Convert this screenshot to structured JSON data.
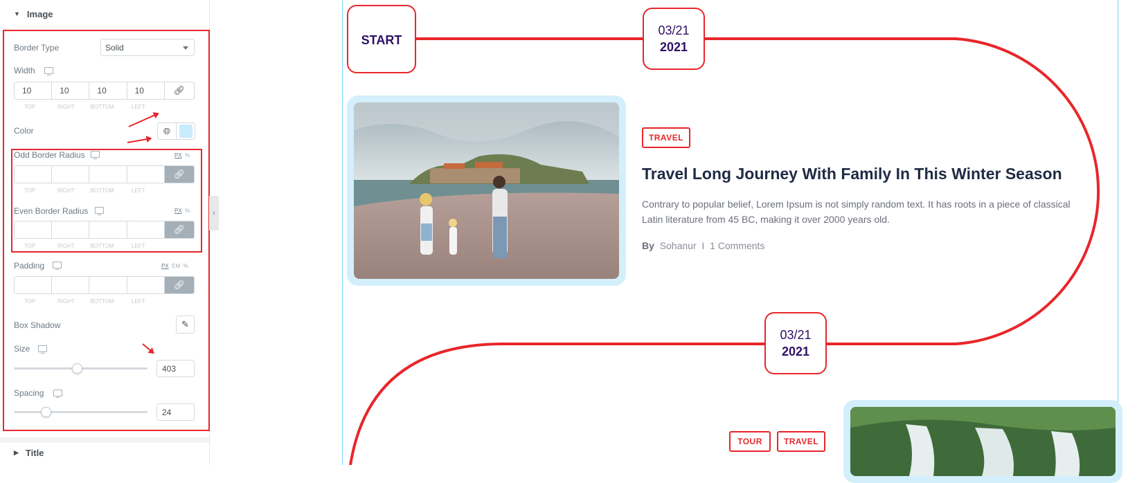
{
  "panel": {
    "image_section": "Image",
    "title_section": "Title",
    "border_type": {
      "label": "Border Type",
      "value": "Solid"
    },
    "width": {
      "label": "Width",
      "values": [
        "10",
        "10",
        "10",
        "10"
      ]
    },
    "dim_labels": [
      "TOP",
      "RIGHT",
      "BOTTOM",
      "LEFT",
      ""
    ],
    "color": {
      "label": "Color",
      "swatch": "#c8ecfb"
    },
    "odd_radius": {
      "label": "Odd Border Radius",
      "unit_px": "PX",
      "unit_pct": "%"
    },
    "even_radius": {
      "label": "Even Border Radius",
      "unit_px": "PX",
      "unit_pct": "%"
    },
    "padding": {
      "label": "Padding",
      "unit_px": "PX",
      "unit_em": "EM",
      "unit_pct": "%"
    },
    "box_shadow": {
      "label": "Box Shadow"
    },
    "size": {
      "label": "Size",
      "value": "403",
      "level": 0.47
    },
    "spacing": {
      "label": "Spacing",
      "value": "24",
      "level": 0.24
    }
  },
  "timeline": {
    "start_label": "START",
    "node1": {
      "date": "03/21",
      "year": "2021"
    },
    "node2": {
      "date": "03/21",
      "year": "2021"
    },
    "post1": {
      "tag": "TRAVEL",
      "title": "Travel Long Journey With Family In This Winter Season",
      "excerpt": "Contrary to popular belief, Lorem Ipsum is not simply random text. It has roots in a piece of classical Latin literature from 45 BC, making it over 2000 years old.",
      "by": "By",
      "author": "Sohanur",
      "separator": "I",
      "comments": "1 Comments"
    },
    "post2": {
      "tags": [
        "TOUR",
        "TRAVEL"
      ]
    }
  },
  "colors": {
    "accent": "#e8262b",
    "frame": "#d3effc",
    "heading": "#2e1065"
  }
}
